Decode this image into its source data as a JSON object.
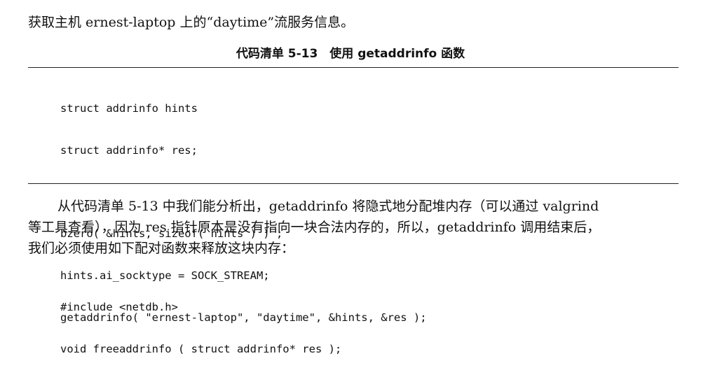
{
  "intro": "获取主机 ernest-laptop 上的“daytime”流服务信息。",
  "listing": {
    "title": "代码清单 5-13　使用 getaddrinfo 函数",
    "lines_a": [
      "struct addrinfo hints",
      "struct addrinfo* res;"
    ],
    "lines_b": [
      "bzero( &hints, sizeof( hints ) ) ;",
      "hints.ai_socktype = SOCK_STREAM;",
      "getaddrinfo( \"ernest-laptop\", \"daytime\", &hints, &res );"
    ]
  },
  "paragraph": [
    "从代码清单 5-13 中我们能分析出，getaddrinfo 将隐式地分配堆内存（可以通过 valgrind",
    "等工具查看），因为 res 指针原本是没有指向一块合法内存的，所以，getaddrinfo 调用结束后，",
    "我们必须使用如下配对函数来释放这块内存："
  ],
  "declaration": [
    "#include <netdb.h>",
    "void freeaddrinfo ( struct addrinfo* res );"
  ]
}
